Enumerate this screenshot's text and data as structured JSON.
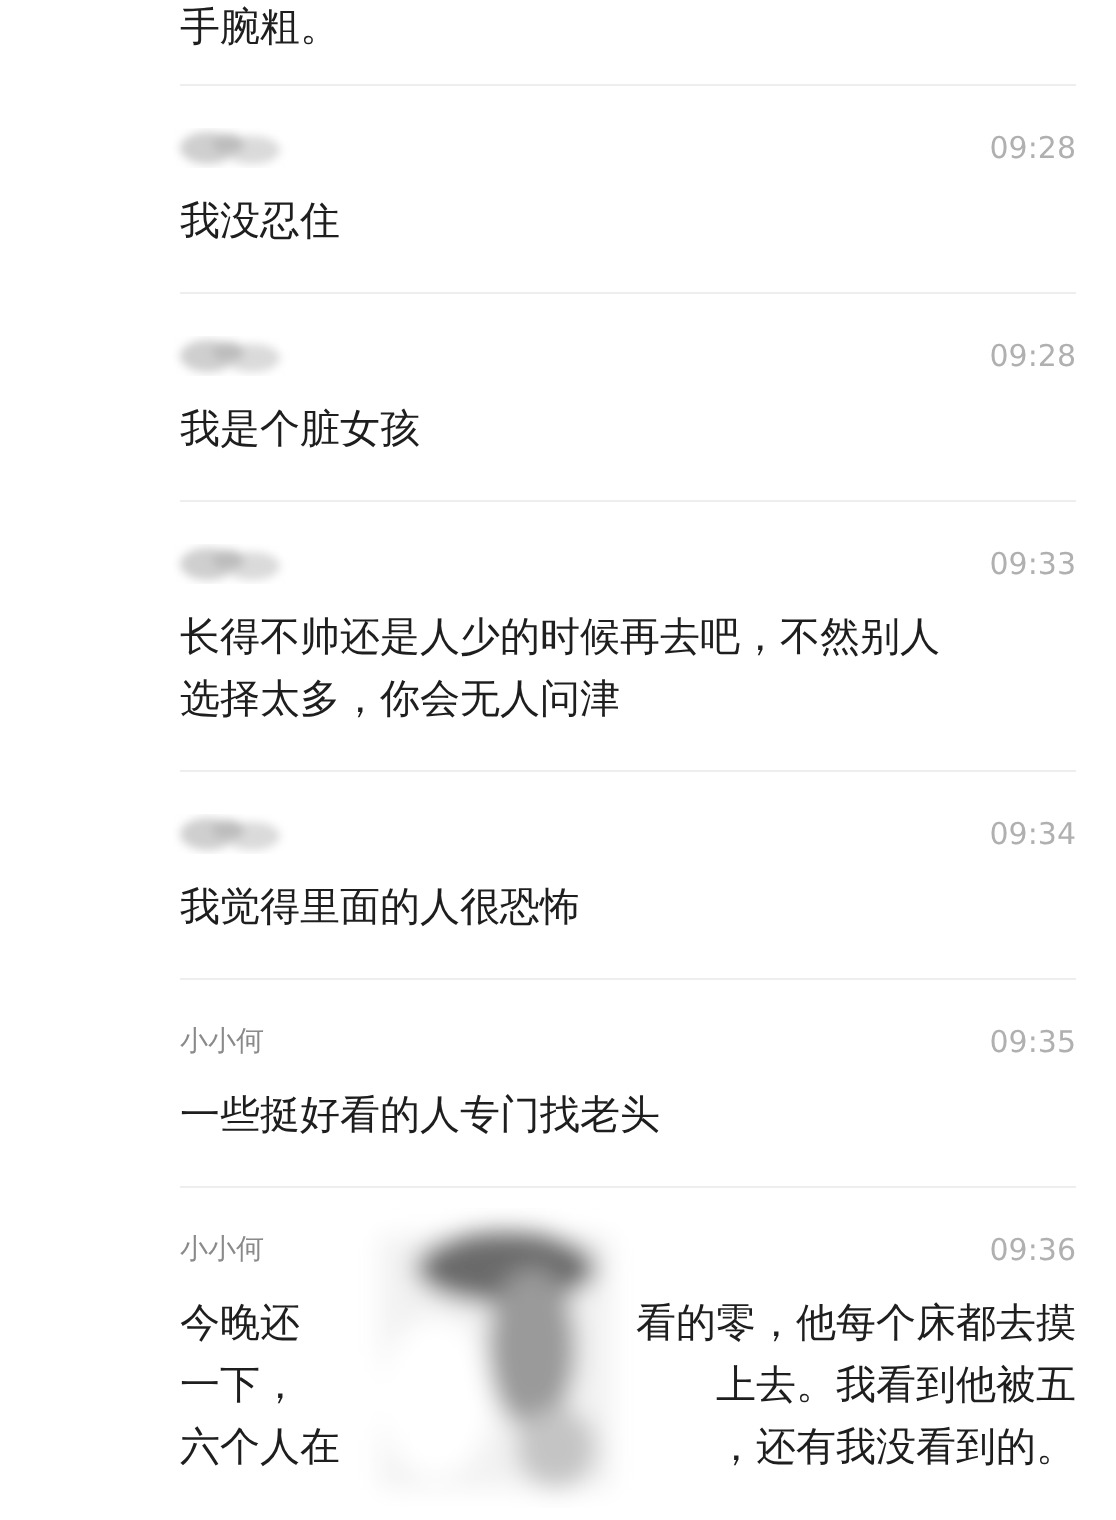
{
  "top_fragment": {
    "text": "手腕粗。"
  },
  "comments": [
    {
      "author": {
        "kind": "blurred"
      },
      "time": "09:28",
      "lines": [
        [
          "我没忍住"
        ]
      ]
    },
    {
      "author": {
        "kind": "blurred"
      },
      "time": "09:28",
      "lines": [
        [
          "我是个脏女孩"
        ]
      ]
    },
    {
      "author": {
        "kind": "blurred"
      },
      "time": "09:33",
      "lines": [
        [
          "长得不帅还是人少的时候再去吧，不然别人"
        ],
        [
          "选择太多，你会无人问津"
        ]
      ]
    },
    {
      "author": {
        "kind": "blurred"
      },
      "time": "09:34",
      "lines": [
        [
          "我觉得里面的人很恐怖"
        ]
      ]
    },
    {
      "author": {
        "kind": "text",
        "name": "小小何"
      },
      "time": "09:35",
      "lines": [
        [
          "一些挺好看的人专门找老头"
        ]
      ]
    },
    {
      "author": {
        "kind": "text",
        "name": "小小何"
      },
      "time": "09:36",
      "obscured": true,
      "lines": [
        [
          "今晚还",
          "看的零，他每个床都去摸"
        ],
        [
          "一下，",
          "上去。我看到他被五"
        ],
        [
          "六个人在",
          "，还有我没看到的。"
        ]
      ]
    }
  ]
}
